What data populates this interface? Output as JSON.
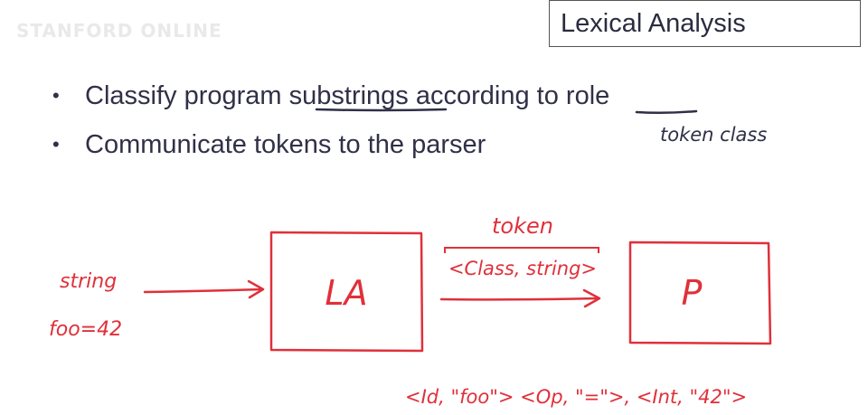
{
  "watermark": "STANFORD ONLINE",
  "title": "Lexical Analysis",
  "bullets": [
    {
      "before": "Classify program ",
      "underlined_1": "substrings",
      "middle": " according to ",
      "underlined_2": "role"
    },
    {
      "text": "Communicate tokens to the parser"
    }
  ],
  "annotations": {
    "role_note": "token class",
    "token_label": "token",
    "pair": "<Class, string>",
    "input_label": "string",
    "input_example": "foo=42",
    "lexer_box": "LA",
    "parser_box": "P",
    "token_list": "<Id, \"foo\">  <Op, \"=\">, <Int, \"42\">"
  },
  "colors": {
    "text": "#303048",
    "ink": "#e0303a",
    "title_border": "#555555"
  }
}
